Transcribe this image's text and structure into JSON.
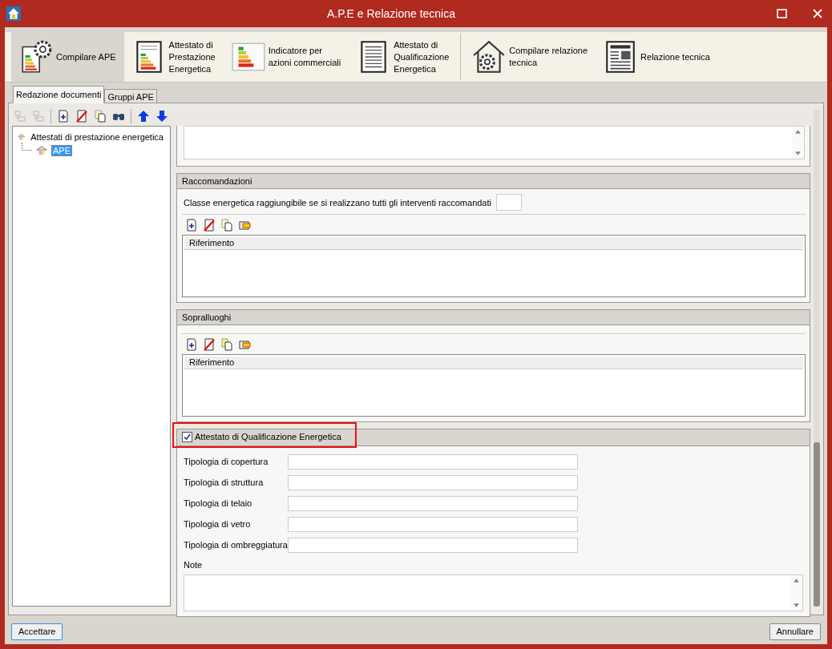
{
  "window": {
    "title": "A.P.E e Relazione tecnica"
  },
  "ribbon": {
    "groups": [
      [
        {
          "kind": "gear-chart",
          "label": "Compilare APE",
          "selected": true
        },
        {
          "kind": "doc-bars",
          "label": "Attestato di\nPrestazione\nEnergetica",
          "selected": false
        },
        {
          "kind": "bars",
          "label": "Indicatore per\nazioni commerciali",
          "selected": false
        },
        {
          "kind": "doc-lines",
          "label": "Attestato di\nQualificazione\nEnergetica",
          "selected": false
        }
      ],
      [
        {
          "kind": "house-gear",
          "label": "Compilare relazione\ntecnica",
          "selected": false
        },
        {
          "kind": "newspaper",
          "label": "Relazione tecnica",
          "selected": false
        }
      ]
    ]
  },
  "tabs": [
    {
      "label": "Redazione documenti",
      "selected": true
    },
    {
      "label": "Gruppi APE",
      "selected": false
    }
  ],
  "toolbar": [
    {
      "kind": "tree-add",
      "disabled": true
    },
    {
      "kind": "tree-remove",
      "disabled": true
    },
    {
      "kind": "sep"
    },
    {
      "kind": "new",
      "disabled": false
    },
    {
      "kind": "delete",
      "disabled": false
    },
    {
      "kind": "copy",
      "disabled": false
    },
    {
      "kind": "find",
      "disabled": false
    },
    {
      "kind": "sep"
    },
    {
      "kind": "up",
      "disabled": false
    },
    {
      "kind": "down",
      "disabled": false
    }
  ],
  "tree": [
    {
      "label": "Attestati di prestazione energetica",
      "selected": false,
      "children": [
        {
          "label": "APE",
          "selected": true
        }
      ]
    }
  ],
  "raccomandazioni": {
    "title": "Raccomandazioni",
    "class_label": "Classe energetica raggiungibile se si realizzano tutti gli interventi raccomandati",
    "tools": [
      {
        "kind": "new"
      },
      {
        "kind": "delete"
      },
      {
        "kind": "copy"
      },
      {
        "kind": "edit"
      }
    ],
    "column": "Riferimento"
  },
  "sopralluoghi": {
    "title": "Sopralluoghi",
    "tools": [
      {
        "kind": "new"
      },
      {
        "kind": "delete"
      },
      {
        "kind": "copy-filled"
      },
      {
        "kind": "edit"
      }
    ],
    "column": "Riferimento"
  },
  "aqe": {
    "title": "Attestato di Qualificazione Energetica",
    "checked": true,
    "highlighted": true,
    "fields": [
      {
        "label": "Tipologia di copertura"
      },
      {
        "label": "Tipologia di struttura"
      },
      {
        "label": "Tipologia di telaio"
      },
      {
        "label": "Tipologia di vetro"
      },
      {
        "label": "Tipologia di ombreggiatura"
      }
    ],
    "note_label": "Note"
  },
  "buttons": {
    "ok": "Accettare",
    "cancel": "Annullare"
  }
}
